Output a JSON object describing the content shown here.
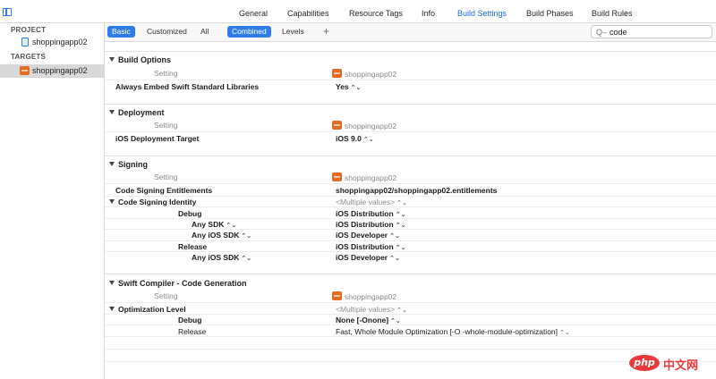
{
  "tabs": [
    "General",
    "Capabilities",
    "Resource Tags",
    "Info",
    "Build Settings",
    "Build Phases",
    "Build Rules"
  ],
  "active_tab": "Build Settings",
  "sidebar": {
    "project_header": "PROJECT",
    "project_item": "shoppingapp02",
    "targets_header": "TARGETS",
    "target_item": "shoppingapp02"
  },
  "filter": {
    "basic": "Basic",
    "customized": "Customized",
    "all": "All",
    "combined": "Combined",
    "levels": "Levels",
    "plus": "+",
    "search_icon": "Q–",
    "search_value": "code"
  },
  "col_setting": "Setting",
  "col_target": "shoppingapp02",
  "sections": {
    "build_options": {
      "title": "Build Options",
      "r1_label": "Always Embed Swift Standard Libraries",
      "r1_value": "Yes"
    },
    "deployment": {
      "title": "Deployment",
      "r1_label": "iOS Deployment Target",
      "r1_value": "iOS 9.0"
    },
    "signing": {
      "title": "Signing",
      "entitlements_label": "Code Signing Entitlements",
      "entitlements_value": "shoppingapp02/shoppingapp02.entitlements",
      "identity_label": "Code Signing Identity",
      "identity_value": "<Multiple values>",
      "debug_label": "Debug",
      "debug_value": "iOS Distribution",
      "debug_sdk_label": "Any SDK",
      "debug_sdk_value": "iOS Distribution",
      "debug_ios_label": "Any iOS SDK",
      "debug_ios_value": "iOS Developer",
      "release_label": "Release",
      "release_value": "iOS Distribution",
      "release_ios_label": "Any iOS SDK",
      "release_ios_value": "iOS Developer"
    },
    "swift": {
      "title": "Swift Compiler - Code Generation",
      "opt_label": "Optimization Level",
      "opt_value": "<Multiple values>",
      "debug_label": "Debug",
      "debug_value": "None [-Onone]",
      "release_label": "Release",
      "release_value": "Fast, Whole Module Optimization  [-O -whole-module-optimization]"
    }
  },
  "stepper_glyph": "⌃⌄",
  "watermark": {
    "logo": "php",
    "text": "中文网"
  },
  "colors": {
    "accent": "#2f7ce9",
    "app_icon": "#e46a24",
    "watermark": "#e83a3a"
  }
}
